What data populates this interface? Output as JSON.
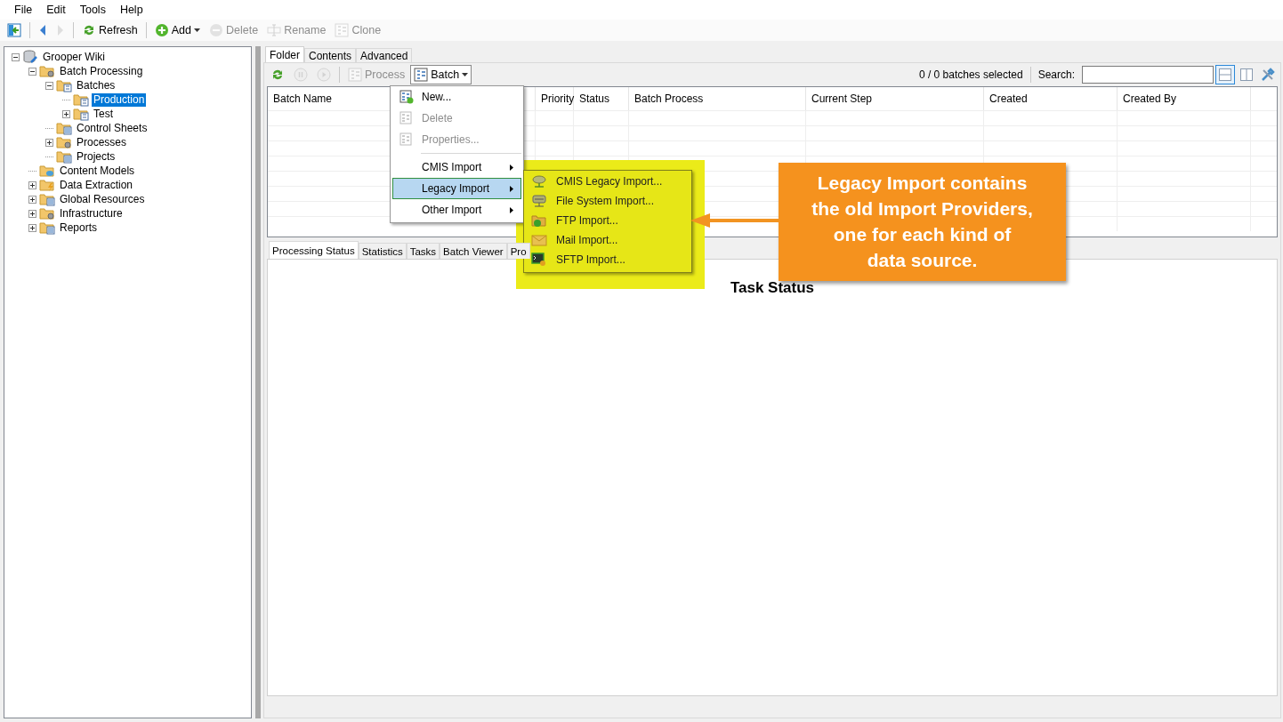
{
  "menu_bar": [
    "File",
    "Edit",
    "Tools",
    "Help"
  ],
  "toolbar": [
    {
      "kind": "tree-toggle",
      "disabled": false
    },
    {
      "kind": "back",
      "disabled": false
    },
    {
      "kind": "forward",
      "disabled": true
    },
    {
      "kind": "refresh",
      "label": "Refresh",
      "disabled": false
    },
    {
      "kind": "add",
      "label": "Add",
      "disabled": false
    },
    {
      "kind": "delete",
      "label": "Delete",
      "disabled": true
    },
    {
      "kind": "rename",
      "label": "Rename",
      "disabled": true
    },
    {
      "kind": "clone",
      "label": "Clone",
      "disabled": true
    }
  ],
  "tree": [
    {
      "label": "Grooper Wiki",
      "kind": "branch",
      "expanded": true,
      "selected": false,
      "children": [
        {
          "label": "Batch Processing",
          "kind": "branch",
          "expanded": true,
          "selected": false,
          "children": [
            {
              "label": "Batches",
              "kind": "branch",
              "expanded": true,
              "selected": false,
              "children": [
                {
                  "label": "Production",
                  "kind": "leaf",
                  "selected": true
                },
                {
                  "label": "Test",
                  "kind": "branch",
                  "expanded": false,
                  "selected": false
                }
              ]
            },
            {
              "label": "Control Sheets",
              "kind": "leaf",
              "selected": false
            },
            {
              "label": "Processes",
              "kind": "branch",
              "expanded": false,
              "selected": false
            },
            {
              "label": "Projects",
              "kind": "leaf",
              "selected": false
            }
          ]
        },
        {
          "label": "Content Models",
          "kind": "leaf",
          "selected": false
        },
        {
          "label": "Data Extraction",
          "kind": "branch",
          "expanded": false,
          "selected": false
        },
        {
          "label": "Global Resources",
          "kind": "branch",
          "expanded": false,
          "selected": false
        },
        {
          "label": "Infrastructure",
          "kind": "branch",
          "expanded": false,
          "selected": false
        },
        {
          "label": "Reports",
          "kind": "branch",
          "expanded": false,
          "selected": false
        }
      ]
    }
  ],
  "tabs": [
    {
      "label": "Folder",
      "selected": true
    },
    {
      "label": "Contents",
      "selected": false
    },
    {
      "label": "Advanced",
      "selected": false
    }
  ],
  "batch_toolbar": {
    "buttons": [
      {
        "kind": "refresh",
        "disabled": false
      },
      {
        "kind": "pause",
        "disabled": true
      },
      {
        "kind": "play",
        "disabled": true
      },
      {
        "kind": "process",
        "label": "Process",
        "disabled": true
      },
      {
        "kind": "batch",
        "label": "Batch",
        "disabled": false
      }
    ],
    "selection": "0 / 0 batches selected",
    "search_label": "Search:",
    "layouts": [
      {
        "kind": "horizontal",
        "selected": true
      },
      {
        "kind": "vertical",
        "selected": false
      }
    ]
  },
  "table": {
    "columns": [
      "Batch Name",
      "Priority",
      "Status",
      "Batch Process",
      "Current Step",
      "Created",
      "Created By"
    ]
  },
  "batch_menu": [
    {
      "kind": "item",
      "label": "New...",
      "disabled": false,
      "selected": false,
      "submenu": false
    },
    {
      "kind": "item",
      "label": "Delete",
      "disabled": true,
      "selected": false,
      "submenu": false
    },
    {
      "kind": "item",
      "label": "Properties...",
      "disabled": true,
      "selected": false,
      "submenu": false
    },
    {
      "kind": "separator"
    },
    {
      "kind": "item",
      "label": "CMIS Import",
      "disabled": false,
      "selected": false,
      "submenu": true
    },
    {
      "kind": "item",
      "label": "Legacy Import",
      "disabled": false,
      "selected": true,
      "submenu": true
    },
    {
      "kind": "item",
      "label": "Other Import",
      "disabled": false,
      "selected": false,
      "submenu": true
    }
  ],
  "legacy_menu": [
    "CMIS Legacy Import...",
    "File System Import...",
    "FTP Import...",
    "Mail Import...",
    "SFTP Import..."
  ],
  "bottom_tabs": [
    {
      "label": "Processing Status",
      "selected": true
    },
    {
      "label": "Statistics",
      "selected": false
    },
    {
      "label": "Tasks",
      "selected": false
    },
    {
      "label": "Batch Viewer",
      "selected": false
    },
    {
      "label": "Pro",
      "selected": false
    }
  ],
  "panel_title": "Task Status",
  "callout": {
    "lines": [
      "Legacy Import contains",
      "the old Import Providers,",
      "one for each kind of",
      "data source."
    ]
  }
}
